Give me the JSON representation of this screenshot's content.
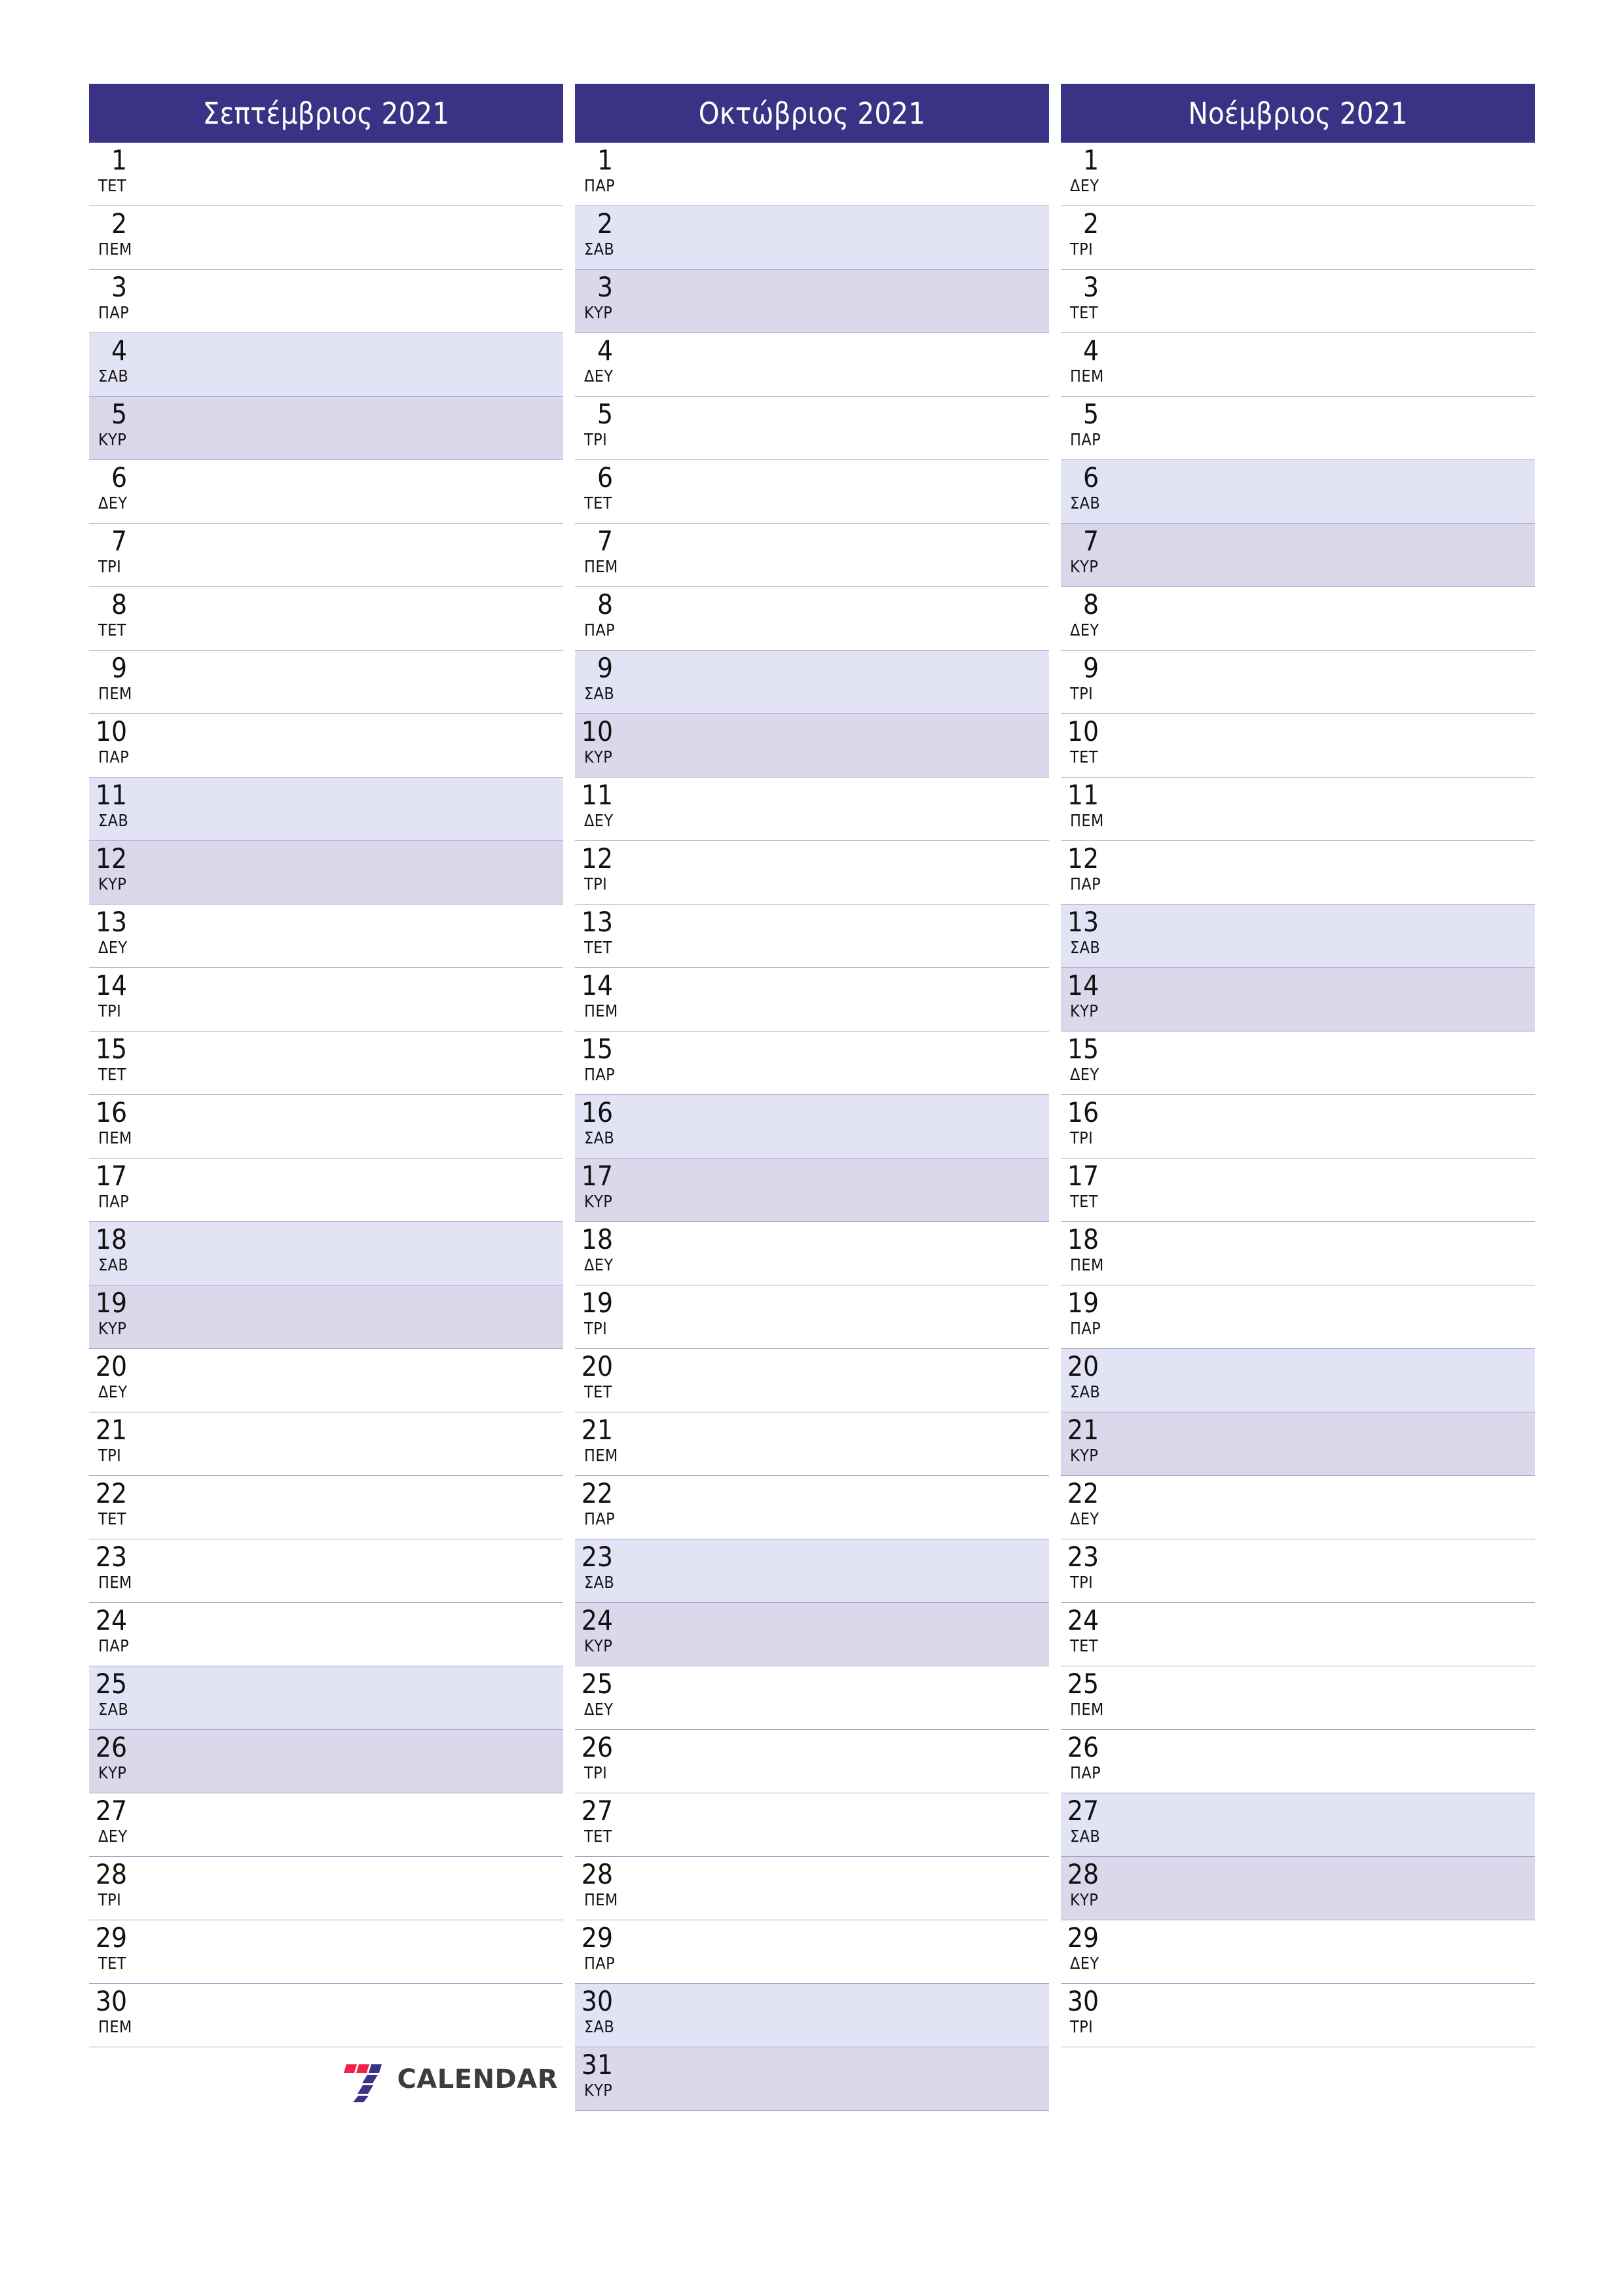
{
  "document": {
    "type": "printable-calendar",
    "year": "2021",
    "orientation": "portrait"
  },
  "colors": {
    "header_bg": "#3a3285",
    "header_text": "#ffffff",
    "saturday_bg": "#e3e3f6",
    "sunday_bg": "#dcd8eb",
    "row_border": "#a9a3c8",
    "day_text": "#111111",
    "logo_red": "#f4204a",
    "logo_blue": "#3a3285",
    "logo_word": "#3c3c3e",
    "page_bg": "#ffffff"
  },
  "brand": {
    "word": "CALENDAR",
    "mark": "seven-logo-icon"
  },
  "months": [
    {
      "id": "september",
      "title": "Σεπτέμβριος 2021",
      "days": [
        {
          "num": "1",
          "abbr": "ΤΕΤ",
          "kind": "weekday"
        },
        {
          "num": "2",
          "abbr": "ΠΕΜ",
          "kind": "weekday"
        },
        {
          "num": "3",
          "abbr": "ΠΑΡ",
          "kind": "weekday"
        },
        {
          "num": "4",
          "abbr": "ΣΑΒ",
          "kind": "sat"
        },
        {
          "num": "5",
          "abbr": "ΚΥΡ",
          "kind": "sun"
        },
        {
          "num": "6",
          "abbr": "ΔΕΥ",
          "kind": "weekday"
        },
        {
          "num": "7",
          "abbr": "ΤΡΙ",
          "kind": "weekday"
        },
        {
          "num": "8",
          "abbr": "ΤΕΤ",
          "kind": "weekday"
        },
        {
          "num": "9",
          "abbr": "ΠΕΜ",
          "kind": "weekday"
        },
        {
          "num": "10",
          "abbr": "ΠΑΡ",
          "kind": "weekday"
        },
        {
          "num": "11",
          "abbr": "ΣΑΒ",
          "kind": "sat"
        },
        {
          "num": "12",
          "abbr": "ΚΥΡ",
          "kind": "sun"
        },
        {
          "num": "13",
          "abbr": "ΔΕΥ",
          "kind": "weekday"
        },
        {
          "num": "14",
          "abbr": "ΤΡΙ",
          "kind": "weekday"
        },
        {
          "num": "15",
          "abbr": "ΤΕΤ",
          "kind": "weekday"
        },
        {
          "num": "16",
          "abbr": "ΠΕΜ",
          "kind": "weekday"
        },
        {
          "num": "17",
          "abbr": "ΠΑΡ",
          "kind": "weekday"
        },
        {
          "num": "18",
          "abbr": "ΣΑΒ",
          "kind": "sat"
        },
        {
          "num": "19",
          "abbr": "ΚΥΡ",
          "kind": "sun"
        },
        {
          "num": "20",
          "abbr": "ΔΕΥ",
          "kind": "weekday"
        },
        {
          "num": "21",
          "abbr": "ΤΡΙ",
          "kind": "weekday"
        },
        {
          "num": "22",
          "abbr": "ΤΕΤ",
          "kind": "weekday"
        },
        {
          "num": "23",
          "abbr": "ΠΕΜ",
          "kind": "weekday"
        },
        {
          "num": "24",
          "abbr": "ΠΑΡ",
          "kind": "weekday"
        },
        {
          "num": "25",
          "abbr": "ΣΑΒ",
          "kind": "sat"
        },
        {
          "num": "26",
          "abbr": "ΚΥΡ",
          "kind": "sun"
        },
        {
          "num": "27",
          "abbr": "ΔΕΥ",
          "kind": "weekday"
        },
        {
          "num": "28",
          "abbr": "ΤΡΙ",
          "kind": "weekday"
        },
        {
          "num": "29",
          "abbr": "ΤΕΤ",
          "kind": "weekday"
        },
        {
          "num": "30",
          "abbr": "ΠΕΜ",
          "kind": "weekday"
        }
      ],
      "trailing_logo_row": true
    },
    {
      "id": "october",
      "title": "Οκτώβριος 2021",
      "days": [
        {
          "num": "1",
          "abbr": "ΠΑΡ",
          "kind": "weekday"
        },
        {
          "num": "2",
          "abbr": "ΣΑΒ",
          "kind": "sat"
        },
        {
          "num": "3",
          "abbr": "ΚΥΡ",
          "kind": "sun"
        },
        {
          "num": "4",
          "abbr": "ΔΕΥ",
          "kind": "weekday"
        },
        {
          "num": "5",
          "abbr": "ΤΡΙ",
          "kind": "weekday"
        },
        {
          "num": "6",
          "abbr": "ΤΕΤ",
          "kind": "weekday"
        },
        {
          "num": "7",
          "abbr": "ΠΕΜ",
          "kind": "weekday"
        },
        {
          "num": "8",
          "abbr": "ΠΑΡ",
          "kind": "weekday"
        },
        {
          "num": "9",
          "abbr": "ΣΑΒ",
          "kind": "sat"
        },
        {
          "num": "10",
          "abbr": "ΚΥΡ",
          "kind": "sun"
        },
        {
          "num": "11",
          "abbr": "ΔΕΥ",
          "kind": "weekday"
        },
        {
          "num": "12",
          "abbr": "ΤΡΙ",
          "kind": "weekday"
        },
        {
          "num": "13",
          "abbr": "ΤΕΤ",
          "kind": "weekday"
        },
        {
          "num": "14",
          "abbr": "ΠΕΜ",
          "kind": "weekday"
        },
        {
          "num": "15",
          "abbr": "ΠΑΡ",
          "kind": "weekday"
        },
        {
          "num": "16",
          "abbr": "ΣΑΒ",
          "kind": "sat"
        },
        {
          "num": "17",
          "abbr": "ΚΥΡ",
          "kind": "sun"
        },
        {
          "num": "18",
          "abbr": "ΔΕΥ",
          "kind": "weekday"
        },
        {
          "num": "19",
          "abbr": "ΤΡΙ",
          "kind": "weekday"
        },
        {
          "num": "20",
          "abbr": "ΤΕΤ",
          "kind": "weekday"
        },
        {
          "num": "21",
          "abbr": "ΠΕΜ",
          "kind": "weekday"
        },
        {
          "num": "22",
          "abbr": "ΠΑΡ",
          "kind": "weekday"
        },
        {
          "num": "23",
          "abbr": "ΣΑΒ",
          "kind": "sat"
        },
        {
          "num": "24",
          "abbr": "ΚΥΡ",
          "kind": "sun"
        },
        {
          "num": "25",
          "abbr": "ΔΕΥ",
          "kind": "weekday"
        },
        {
          "num": "26",
          "abbr": "ΤΡΙ",
          "kind": "weekday"
        },
        {
          "num": "27",
          "abbr": "ΤΕΤ",
          "kind": "weekday"
        },
        {
          "num": "28",
          "abbr": "ΠΕΜ",
          "kind": "weekday"
        },
        {
          "num": "29",
          "abbr": "ΠΑΡ",
          "kind": "weekday"
        },
        {
          "num": "30",
          "abbr": "ΣΑΒ",
          "kind": "sat"
        },
        {
          "num": "31",
          "abbr": "ΚΥΡ",
          "kind": "sun"
        }
      ],
      "trailing_logo_row": false
    },
    {
      "id": "november",
      "title": "Νοέμβριος 2021",
      "days": [
        {
          "num": "1",
          "abbr": "ΔΕΥ",
          "kind": "weekday"
        },
        {
          "num": "2",
          "abbr": "ΤΡΙ",
          "kind": "weekday"
        },
        {
          "num": "3",
          "abbr": "ΤΕΤ",
          "kind": "weekday"
        },
        {
          "num": "4",
          "abbr": "ΠΕΜ",
          "kind": "weekday"
        },
        {
          "num": "5",
          "abbr": "ΠΑΡ",
          "kind": "weekday"
        },
        {
          "num": "6",
          "abbr": "ΣΑΒ",
          "kind": "sat"
        },
        {
          "num": "7",
          "abbr": "ΚΥΡ",
          "kind": "sun"
        },
        {
          "num": "8",
          "abbr": "ΔΕΥ",
          "kind": "weekday"
        },
        {
          "num": "9",
          "abbr": "ΤΡΙ",
          "kind": "weekday"
        },
        {
          "num": "10",
          "abbr": "ΤΕΤ",
          "kind": "weekday"
        },
        {
          "num": "11",
          "abbr": "ΠΕΜ",
          "kind": "weekday"
        },
        {
          "num": "12",
          "abbr": "ΠΑΡ",
          "kind": "weekday"
        },
        {
          "num": "13",
          "abbr": "ΣΑΒ",
          "kind": "sat"
        },
        {
          "num": "14",
          "abbr": "ΚΥΡ",
          "kind": "sun"
        },
        {
          "num": "15",
          "abbr": "ΔΕΥ",
          "kind": "weekday"
        },
        {
          "num": "16",
          "abbr": "ΤΡΙ",
          "kind": "weekday"
        },
        {
          "num": "17",
          "abbr": "ΤΕΤ",
          "kind": "weekday"
        },
        {
          "num": "18",
          "abbr": "ΠΕΜ",
          "kind": "weekday"
        },
        {
          "num": "19",
          "abbr": "ΠΑΡ",
          "kind": "weekday"
        },
        {
          "num": "20",
          "abbr": "ΣΑΒ",
          "kind": "sat"
        },
        {
          "num": "21",
          "abbr": "ΚΥΡ",
          "kind": "sun"
        },
        {
          "num": "22",
          "abbr": "ΔΕΥ",
          "kind": "weekday"
        },
        {
          "num": "23",
          "abbr": "ΤΡΙ",
          "kind": "weekday"
        },
        {
          "num": "24",
          "abbr": "ΤΕΤ",
          "kind": "weekday"
        },
        {
          "num": "25",
          "abbr": "ΠΕΜ",
          "kind": "weekday"
        },
        {
          "num": "26",
          "abbr": "ΠΑΡ",
          "kind": "weekday"
        },
        {
          "num": "27",
          "abbr": "ΣΑΒ",
          "kind": "sat"
        },
        {
          "num": "28",
          "abbr": "ΚΥΡ",
          "kind": "sun"
        },
        {
          "num": "29",
          "abbr": "ΔΕΥ",
          "kind": "weekday"
        },
        {
          "num": "30",
          "abbr": "ΤΡΙ",
          "kind": "weekday"
        }
      ],
      "trailing_logo_row": false
    }
  ]
}
